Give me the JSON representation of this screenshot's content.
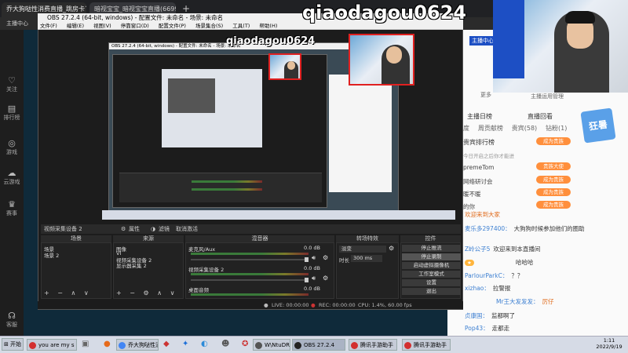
{
  "browser": {
    "tabs": [
      {
        "label": "乔大狗哒性消费直播_跳房卡了"
      },
      {
        "label": "暗视宝宝_暗视宝宝直播(6699"
      }
    ],
    "new_tab": "+",
    "window_title": "主播中心"
  },
  "sidebar": {
    "items": [
      {
        "label": "关注",
        "icon": "heart-icon"
      },
      {
        "label": "排行榜",
        "icon": "ranking-icon"
      },
      {
        "label": "游戏",
        "icon": "gamepad-icon"
      },
      {
        "label": "云游戏",
        "icon": "cloud-game-icon"
      },
      {
        "label": "赛事",
        "icon": "trophy-icon"
      },
      {
        "label": "客服",
        "icon": "headset-icon"
      }
    ]
  },
  "watermark": "qiaodagou0624",
  "obs": {
    "title": "OBS 27.2.4 (64-bit, windows) - 配置文件: 未命名 - 场景: 未命名",
    "menu": [
      "文件(F)",
      "编辑(E)",
      "视图(V)",
      "停靠窗口(D)",
      "配置文件(P)",
      "场景集合(S)",
      "工具(T)",
      "帮助(H)"
    ],
    "source_bar": {
      "label": "视频采集设备 2",
      "properties": "属性",
      "filters": "滤镜",
      "activate": "取消激活"
    },
    "docks": {
      "scenes": {
        "title": "场景",
        "items": [
          "场景",
          "场景 2"
        ]
      },
      "sources": {
        "title": "来源",
        "items": [
          "图像",
          "VI",
          "视频采集设备 2",
          "显示器采集 2"
        ]
      },
      "mixer": {
        "title": "混音器",
        "channels": [
          {
            "name": "麦克风/Aux",
            "db": "0.0 dB"
          },
          {
            "name": "视频采集设备 2",
            "db": "0.0 dB"
          },
          {
            "name": "桌面音频",
            "db": "0.0 dB"
          }
        ]
      },
      "transitions": {
        "title": "转场特效",
        "type": "淡变",
        "duration_label": "时长",
        "duration": "300 ms"
      },
      "controls": {
        "title": "控件",
        "buttons": [
          "停止推流",
          "停止录制",
          "启动虚拟摄像机",
          "工作室模式",
          "设置",
          "退出"
        ]
      }
    },
    "status": {
      "live": "LIVE: 00:00:00",
      "rec": "REC: 00:00:00",
      "cpu": "CPU: 1.4%, 60.00 fps"
    }
  },
  "chat": {
    "header": "主播日榜",
    "header_right": "直播回看",
    "tabs": [
      "度",
      "周贡献榜",
      "贵宾(58)",
      "钻粉(1)"
    ],
    "more": "更多",
    "subscribe": "主播运用管理",
    "rank_title": "贵宾排行榜",
    "rank_hint": "今日开启之后你才能进",
    "rank_buttons": [
      "成为贵族",
      "贵族大使",
      "成为贵族",
      "成为贵族",
      "成为贵族"
    ],
    "rank_users": [
      "premeTom",
      "网络研讨会",
      "暖不暖",
      "的你"
    ],
    "promo": "狂暑",
    "messages": [
      {
        "user": "",
        "text": "欢迎来到大家"
      },
      {
        "user": "麦乐多297400：",
        "text": "大狗狗时候参加他们的圈助"
      },
      {
        "user": "Z岭公子5",
        "text": "欢迎来到本直播间"
      },
      {
        "user": "",
        "text": "哈哈哈"
      },
      {
        "user": "ParlourParkC：",
        "text": "？？"
      },
      {
        "user": "xizhao：",
        "text": "拉警报"
      },
      {
        "user": "Mr王大发发发：",
        "text": "厉仔"
      },
      {
        "user": "贞康国：",
        "text": "监都啊了"
      },
      {
        "user": "Pop43：",
        "text": "走都走"
      }
    ]
  },
  "taskbar": {
    "start": "开始",
    "items": [
      {
        "label": "you are my s",
        "color": "#d32f2f"
      },
      {
        "label": "乔大狗哒性消",
        "color": "#4285f4"
      },
      {
        "label": "W\\NtuDRe02",
        "color": "#555"
      },
      {
        "label": "OBS 27.2.4",
        "color": "#222"
      },
      {
        "label": "腾讯手游助手",
        "color": "#d32f2f"
      },
      {
        "label": "腾讯手游助手",
        "color": "#d32f2f"
      }
    ],
    "clock_time": "1:11",
    "clock_date": "2022/9/19"
  }
}
